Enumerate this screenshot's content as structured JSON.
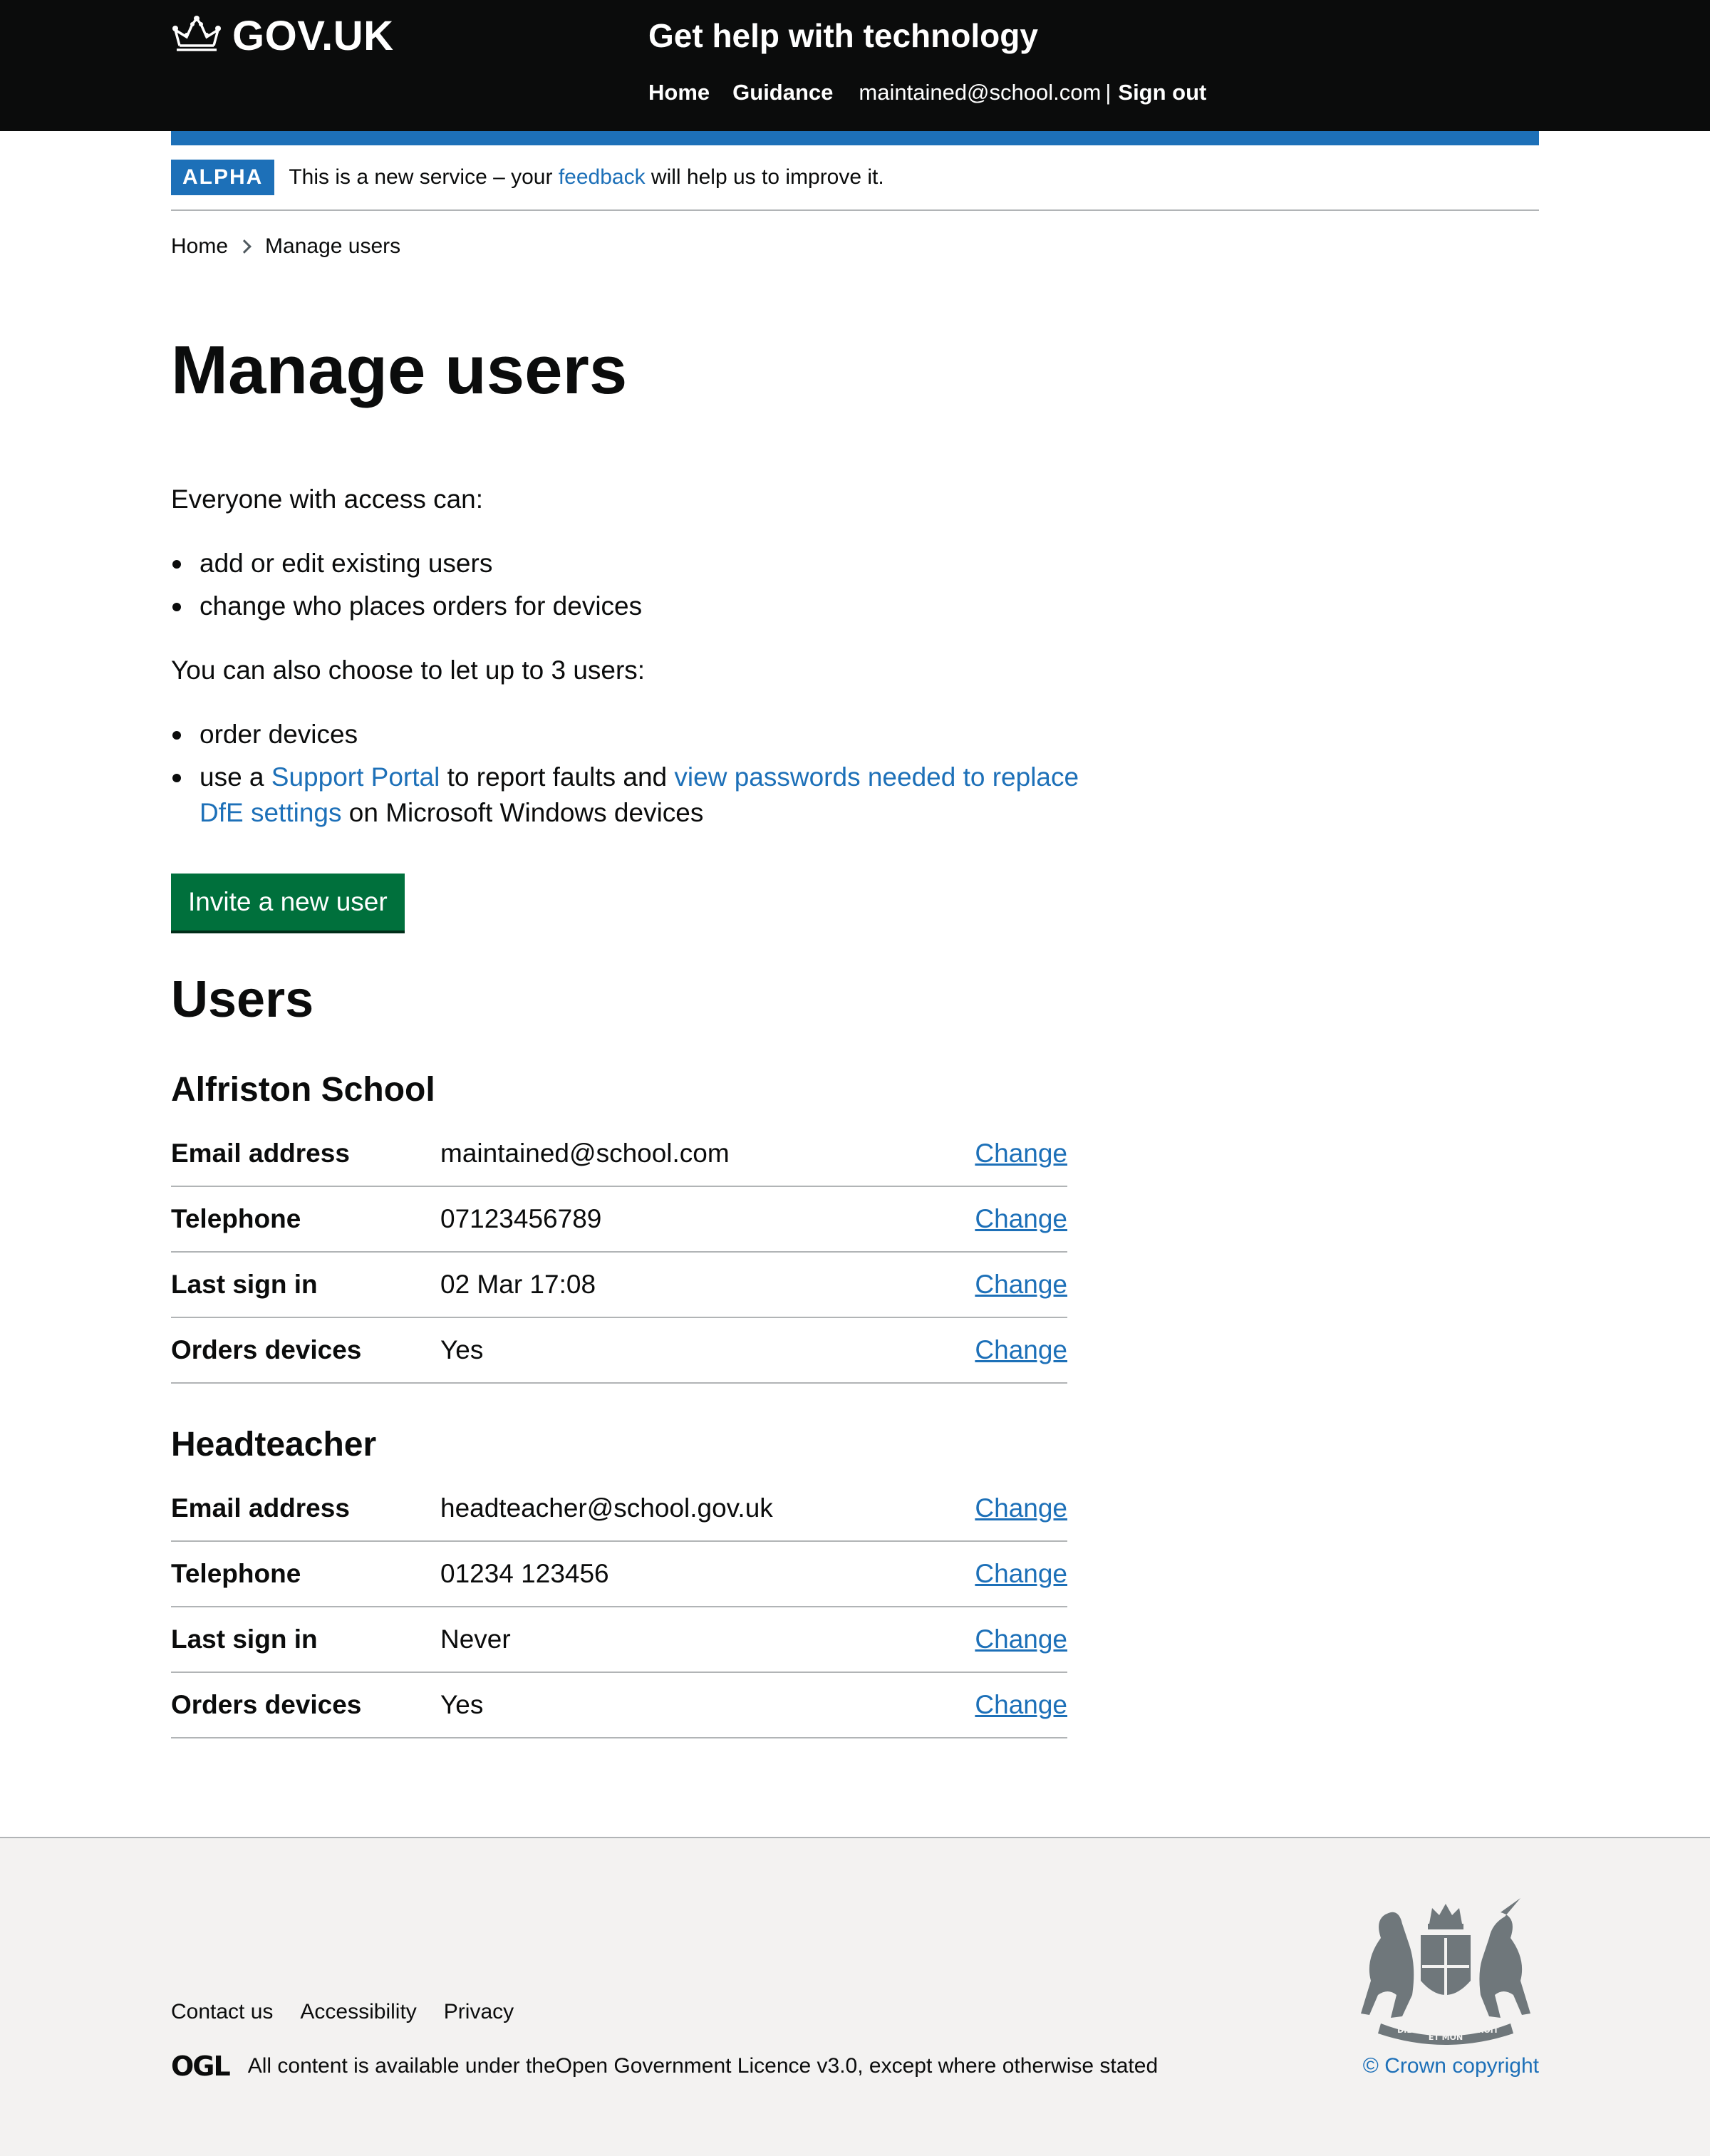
{
  "header": {
    "logo_text": "GOV.UK",
    "service_name": "Get help with technology",
    "nav": {
      "home": "Home",
      "guidance": "Guidance",
      "user_email": "maintained@school.com",
      "separator": "|",
      "sign_out": "Sign out"
    }
  },
  "phase_banner": {
    "tag": "ALPHA",
    "text_before": "This is a new service – your ",
    "link": "feedback",
    "text_after": " will help us to improve it."
  },
  "breadcrumb": {
    "home": "Home",
    "current": "Manage users"
  },
  "page_title": "Manage users",
  "intro": {
    "everyone": "Everyone with access can:",
    "everyone_items": [
      "add or edit existing users",
      "change who places orders for devices"
    ],
    "also": "You can also choose to let up to 3 users:",
    "also_item_1": "order devices",
    "also_item_2": {
      "prefix": "use a ",
      "link1": "Support Portal",
      "middle": " to report faults and ",
      "link2": "view passwords needed to replace DfE settings",
      "suffix": " on Microsoft Windows devices"
    }
  },
  "invite_button": "Invite a new user",
  "users_heading": "Users",
  "users": [
    {
      "name": "Alfriston School",
      "rows": [
        {
          "key": "Email address",
          "value": "maintained@school.com",
          "action": "Change"
        },
        {
          "key": "Telephone",
          "value": "07123456789",
          "action": "Change"
        },
        {
          "key": "Last sign in",
          "value": "02 Mar 17:08",
          "action": "Change"
        },
        {
          "key": "Orders devices",
          "value": "Yes",
          "action": "Change"
        }
      ]
    },
    {
      "name": "Headteacher",
      "rows": [
        {
          "key": "Email address",
          "value": "headteacher@school.gov.uk",
          "action": "Change"
        },
        {
          "key": "Telephone",
          "value": "01234 123456",
          "action": "Change"
        },
        {
          "key": "Last sign in",
          "value": "Never",
          "action": "Change"
        },
        {
          "key": "Orders devices",
          "value": "Yes",
          "action": "Change"
        }
      ]
    }
  ],
  "footer": {
    "links": [
      "Contact us",
      "Accessibility",
      "Privacy"
    ],
    "ogl_logo": "OGL",
    "licence_before": "All content is available under the ",
    "licence_link": "Open Government Licence v3.0",
    "licence_after": ", except where otherwise stated",
    "crest_motto": [
      "DIEU",
      "ET MON",
      "DROIT"
    ],
    "copyright": "© Crown copyright"
  },
  "colors": {
    "header_bg": "#0b0c0c",
    "brand_blue": "#1d70b8",
    "button_green": "#00703c",
    "footer_bg": "#f3f2f1"
  }
}
